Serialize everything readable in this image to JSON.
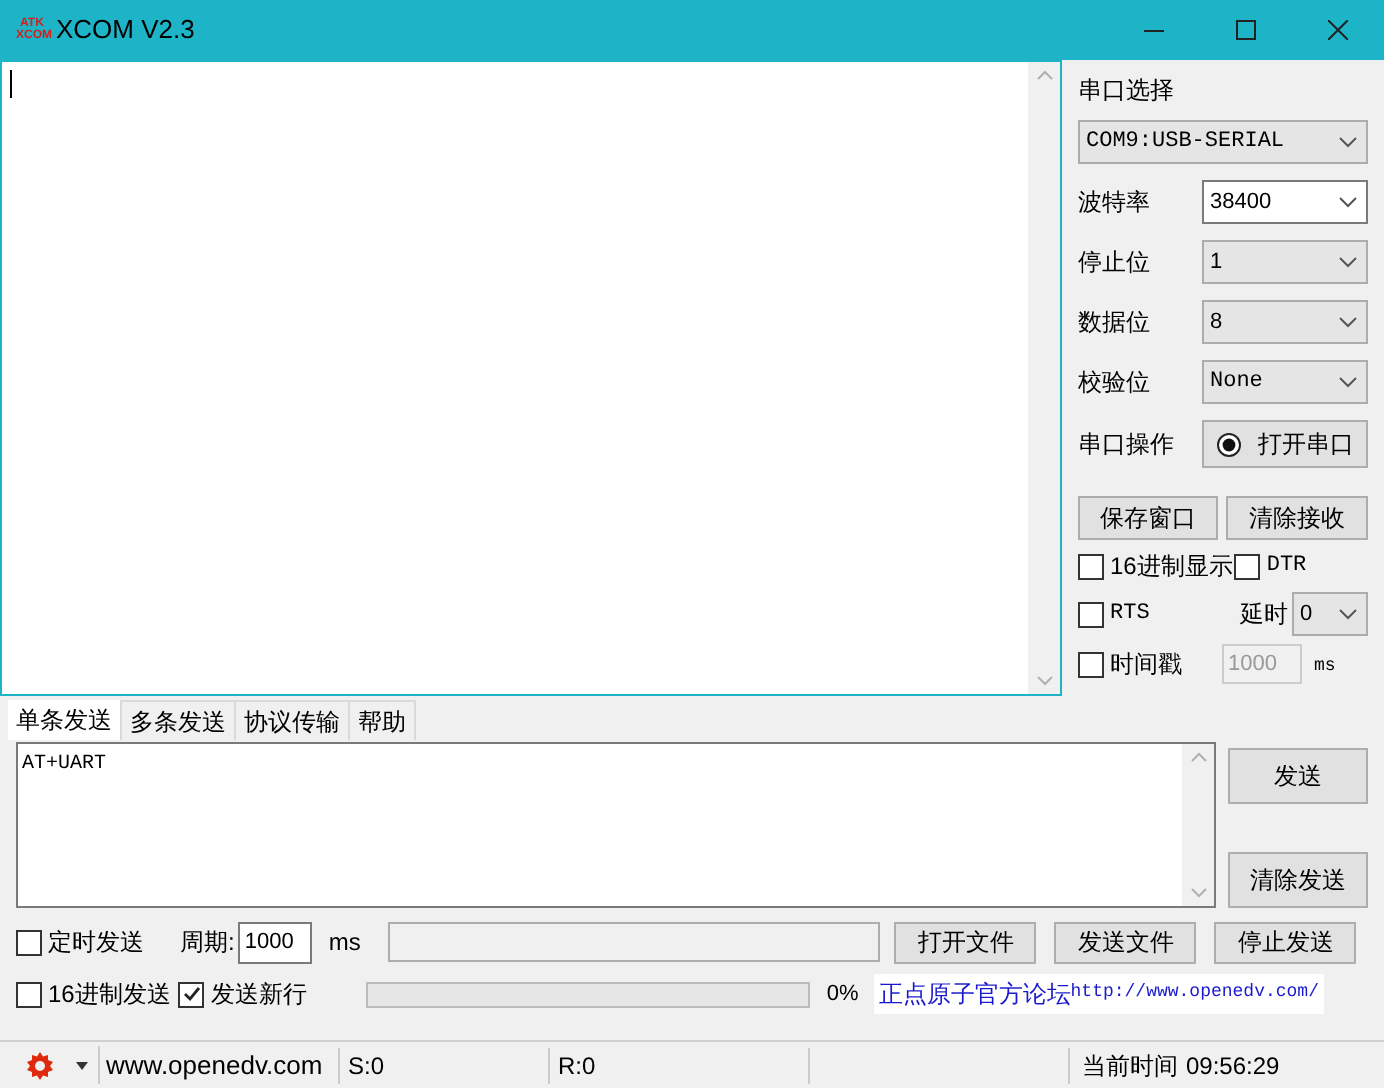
{
  "window": {
    "title": "XCOM V2.3",
    "logo": "ATK XCOM"
  },
  "port_panel": {
    "title": "串口选择",
    "port": "COM9:USB-SERIAL",
    "settings": [
      {
        "label": "波特率",
        "value": "38400",
        "active": true
      },
      {
        "label": "停止位",
        "value": "1",
        "active": false
      },
      {
        "label": "数据位",
        "value": "8",
        "active": false
      },
      {
        "label": "校验位",
        "value": "None",
        "active": false
      }
    ],
    "operation_label": "串口操作",
    "open_button": "打开串口",
    "save_button": "保存窗口",
    "clear_receive_button": "清除接收",
    "hex_display": {
      "label": "16进制显示",
      "checked": false
    },
    "dtr": {
      "label": "DTR",
      "checked": false
    },
    "rts": {
      "label": "RTS",
      "checked": false
    },
    "delay_label": "延时",
    "delay_value": "0",
    "timestamp": {
      "label": "时间戳",
      "checked": false
    },
    "timestamp_interval": "1000",
    "timestamp_unit": "ms"
  },
  "tabs": [
    {
      "label": "单条发送",
      "selected": true
    },
    {
      "label": "多条发送",
      "selected": false
    },
    {
      "label": "协议传输",
      "selected": false
    },
    {
      "label": "帮助",
      "selected": false
    }
  ],
  "send_text": "AT+UART",
  "send_button": "发送",
  "clear_send_button": "清除发送",
  "timed_send": {
    "label": "定时发送",
    "checked": false
  },
  "period_label": "周期:",
  "period_value": "1000",
  "period_unit": "ms",
  "open_file_button": "打开文件",
  "send_file_button": "发送文件",
  "stop_send_button": "停止发送",
  "hex_send": {
    "label": "16进制发送",
    "checked": false
  },
  "send_newline": {
    "label": "发送新行",
    "checked": true
  },
  "file_progress": {
    "level": 0,
    "reading": "0%"
  },
  "forum_name": "正点原子官方论坛",
  "forum_url": "http://www.openedv.com/",
  "status_bar": {
    "website": "www.openedv.com",
    "sent": "S:0",
    "received": "R:0",
    "time_label": "当前时间",
    "time": "09:56:29"
  }
}
